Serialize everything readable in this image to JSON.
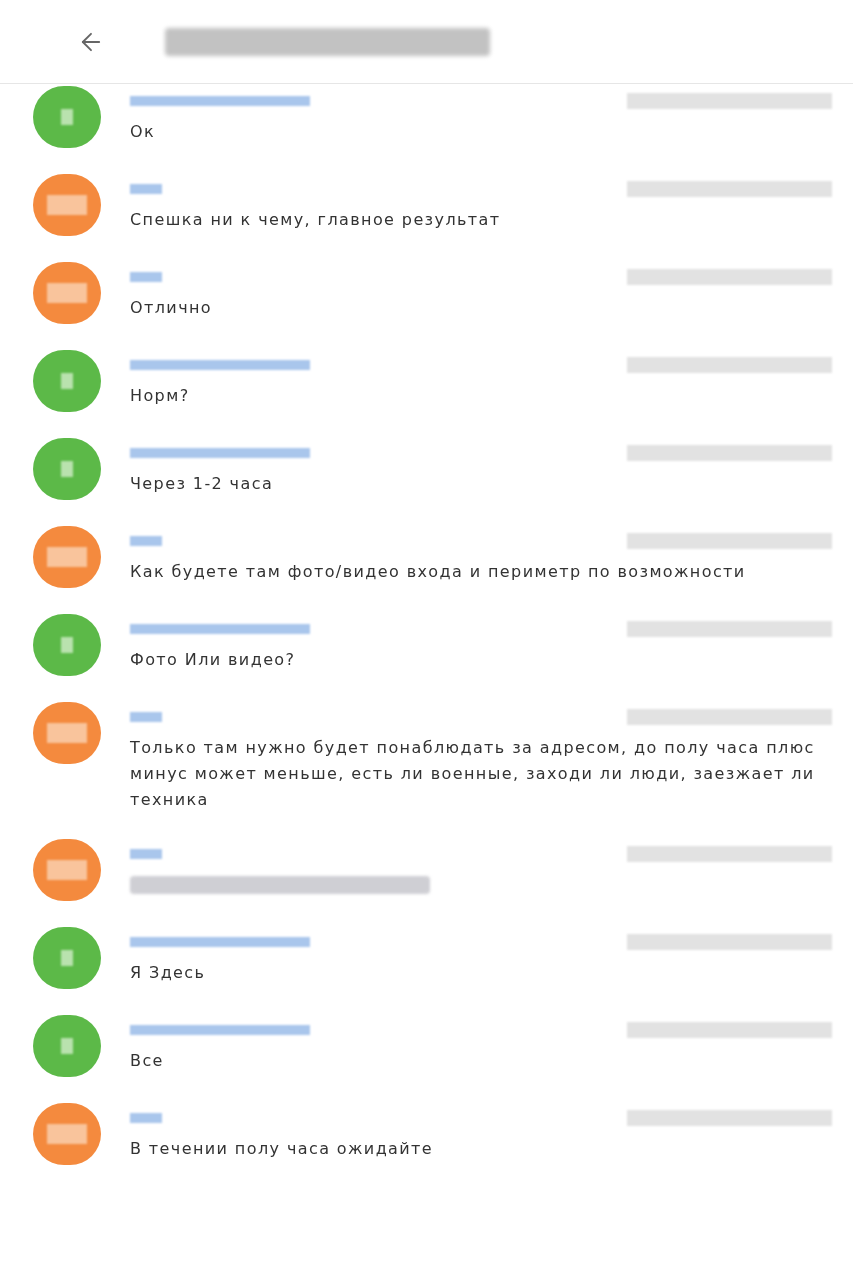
{
  "messages": [
    {
      "outgoing": false,
      "color": "#5cb948",
      "kind": "text",
      "text": "Ок"
    },
    {
      "outgoing": true,
      "color": "#f48a3e",
      "kind": "text",
      "text": "Спешка ни к чему, главное результат"
    },
    {
      "outgoing": true,
      "color": "#f48a3e",
      "kind": "text",
      "text": "Отлично"
    },
    {
      "outgoing": false,
      "color": "#5cb948",
      "kind": "text",
      "text": "Норм?"
    },
    {
      "outgoing": false,
      "color": "#5cb948",
      "kind": "text",
      "text": "Через 1-2 часа"
    },
    {
      "outgoing": true,
      "color": "#f48a3e",
      "kind": "text",
      "text": "Как будете там фото/видео входа и периметр по возможности"
    },
    {
      "outgoing": false,
      "color": "#5cb948",
      "kind": "text",
      "text": "Фото Или видео?"
    },
    {
      "outgoing": true,
      "color": "#f48a3e",
      "kind": "text",
      "text": "Только там нужно будет понаблюдать за адресом, до полу часа плюс минус может меньше, есть ли военные, заходи ли люди, заезжает ли техника"
    },
    {
      "outgoing": true,
      "color": "#f48a3e",
      "kind": "blurred"
    },
    {
      "outgoing": false,
      "color": "#5cb948",
      "kind": "text",
      "text": "Я Здесь"
    },
    {
      "outgoing": false,
      "color": "#5cb948",
      "kind": "text",
      "text": "Все"
    },
    {
      "outgoing": true,
      "color": "#f48a3e",
      "kind": "text",
      "text": "В течении полу часа ожидайте"
    }
  ]
}
